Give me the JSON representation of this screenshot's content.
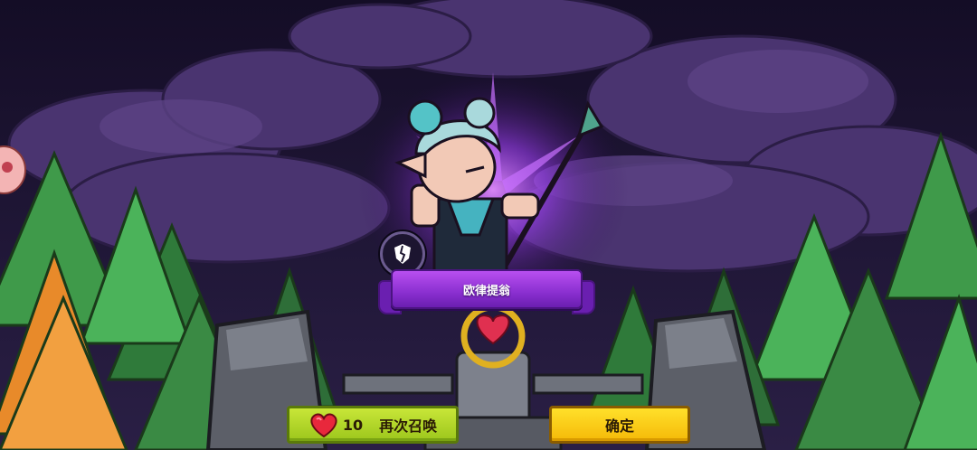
{
  "hero": {
    "name": "欧律提翁",
    "class_icon": "cracked-shield-icon"
  },
  "buttons": {
    "summon_again": {
      "cost": "10",
      "label": "再次召唤",
      "icon": "heart-icon"
    },
    "confirm": {
      "label": "确定"
    }
  },
  "colors": {
    "sky": "#1a1230",
    "clouds": "#4a3470",
    "glow": "#9b3cf0",
    "banner": "#a640e6",
    "summon_button": "#b6d628",
    "confirm_button": "#fbd015"
  }
}
